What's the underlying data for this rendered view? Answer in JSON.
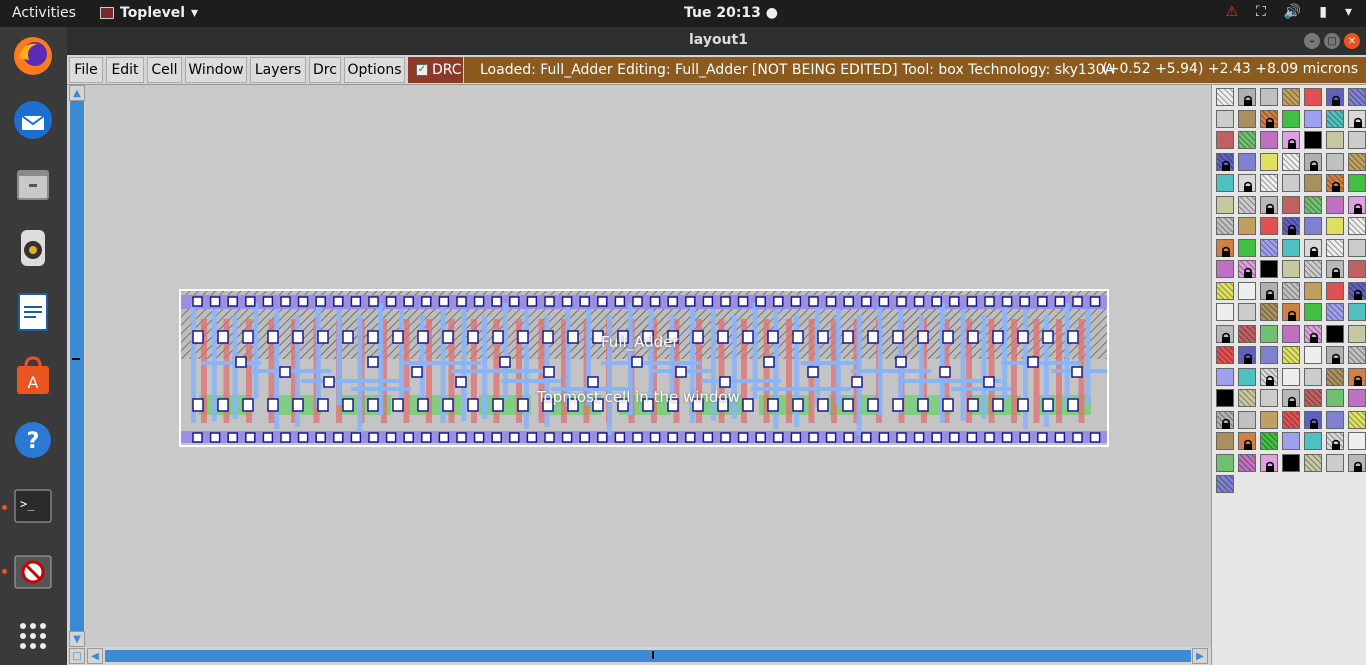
{
  "topbar": {
    "activities": "Activities",
    "app_name": "Toplevel",
    "clock": "Tue 20:13 ●",
    "tray_icons": [
      "warning-icon",
      "network-icon",
      "volume-icon",
      "battery-icon",
      "power-menu-icon"
    ]
  },
  "dock": {
    "items": [
      "firefox",
      "thunderbird",
      "files",
      "rhythmbox",
      "libreoffice-writer",
      "ubuntu-software",
      "help",
      "terminal",
      "magic-layout",
      "show-applications"
    ]
  },
  "window": {
    "title": "layout1"
  },
  "menubar": {
    "items": [
      "File",
      "Edit",
      "Cell",
      "Window",
      "Layers",
      "Drc",
      "Options"
    ],
    "drc_label": "DRC",
    "drc_checked": true,
    "status": "Loaded: Full_Adder Editing: Full_Adder [NOT BEING EDITED] Tool: box  Technology: sky130A",
    "coords": "(+0.52 +5.94) +2.43 +8.09 microns"
  },
  "layout": {
    "cell_name": "Full_Adder",
    "cell_note": "Topmost cell in the window"
  },
  "colors": {
    "status_bg": "#8b5a1e",
    "drc_bg": "#8b3a2a",
    "metal1": "#8ab4f8",
    "locali": "#9b8fe0",
    "poly": "#e07070",
    "diff": "#6bd06b",
    "contact": "#1a1a8a",
    "scrollbar": "#3c8ad4"
  }
}
